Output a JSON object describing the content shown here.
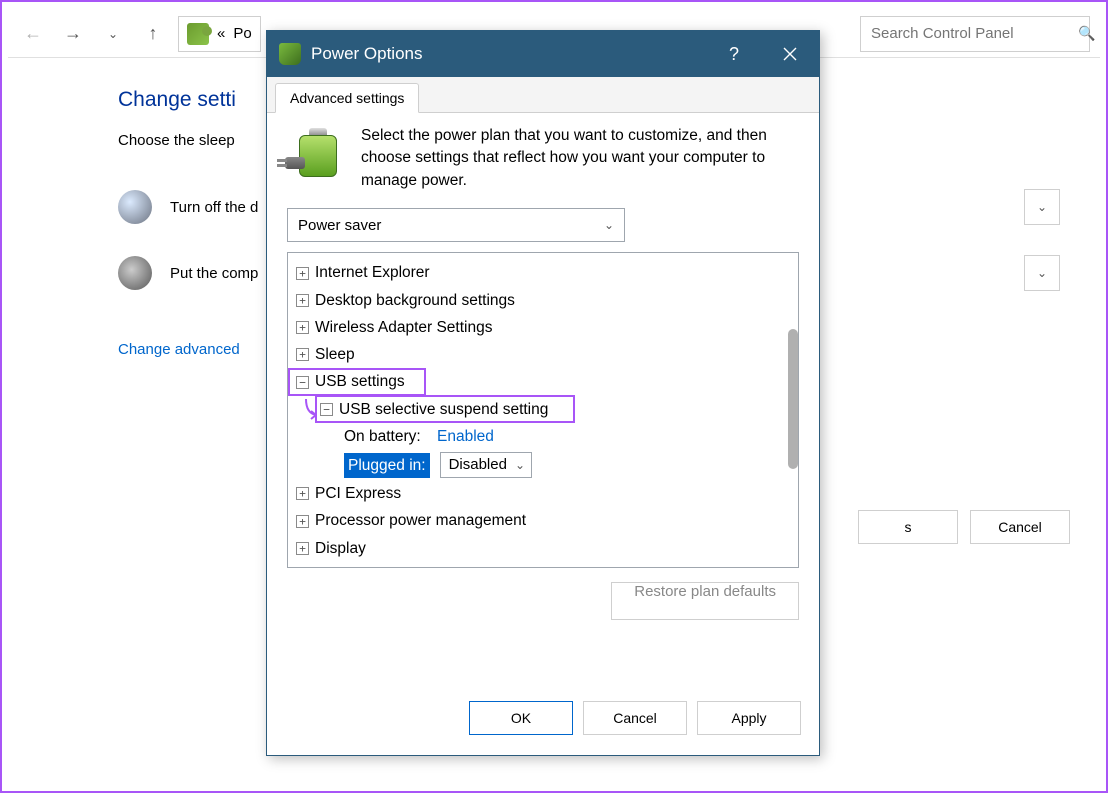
{
  "nav": {
    "crumb_prefix": "«",
    "crumb": "Po"
  },
  "search": {
    "placeholder": "Search Control Panel"
  },
  "cp": {
    "heading": "Change setti",
    "sub": "Choose the sleep",
    "row1": "Turn off the d",
    "row2": "Put the comp",
    "link": "Change advanced",
    "save": "s",
    "cancel": "Cancel"
  },
  "dialog": {
    "title": "Power Options",
    "tab": "Advanced settings",
    "info": "Select the power plan that you want to customize, and then choose settings that reflect how you want your computer to manage power.",
    "plan": "Power saver",
    "tree": {
      "ie": "Internet Explorer",
      "desktop": "Desktop background settings",
      "wireless": "Wireless Adapter Settings",
      "sleep": "Sleep",
      "usb": "USB settings",
      "usb_sel": "USB selective suspend setting",
      "on_batt_label": "On battery:",
      "on_batt_val": "Enabled",
      "plugged_label": "Plugged in:",
      "plugged_val": "Disabled",
      "pci": "PCI Express",
      "proc": "Processor power management",
      "display": "Display"
    },
    "restore": "Restore plan defaults",
    "ok": "OK",
    "cancel": "Cancel",
    "apply": "Apply"
  }
}
